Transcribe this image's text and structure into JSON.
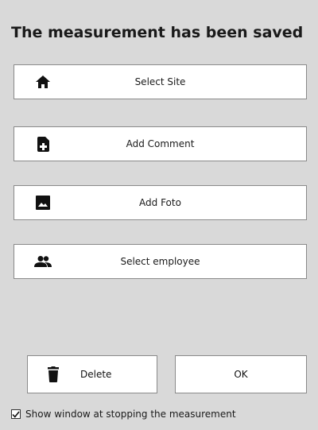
{
  "dialog": {
    "title": "The measurement has been saved"
  },
  "actions": [
    {
      "label": "Select Site",
      "icon": "home-icon"
    },
    {
      "label": "Add Comment",
      "icon": "add-document-icon"
    },
    {
      "label": "Add Foto",
      "icon": "image-icon"
    },
    {
      "label": "Select employee",
      "icon": "people-icon"
    }
  ],
  "footer": {
    "delete_label": "Delete",
    "delete_icon": "trash-icon",
    "ok_label": "OK",
    "checkbox_label": "Show window at stopping the measurement",
    "checkbox_checked": true
  }
}
